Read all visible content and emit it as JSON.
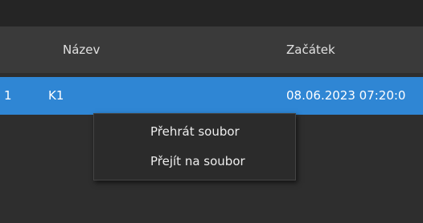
{
  "table": {
    "columns": {
      "name": "Název",
      "start": "Začátek"
    },
    "rows": [
      {
        "index": "1",
        "name": "K1",
        "start": "08.06.2023 07:20:0",
        "selected": true
      }
    ]
  },
  "context_menu": {
    "items": [
      {
        "label": "Přehrát soubor"
      },
      {
        "label": "Přejít na soubor"
      }
    ]
  },
  "colors": {
    "selection": "#2f86d4",
    "background": "#2e2e2e",
    "header_background": "#3a3a3a",
    "menu_background": "#2b2b2b"
  }
}
